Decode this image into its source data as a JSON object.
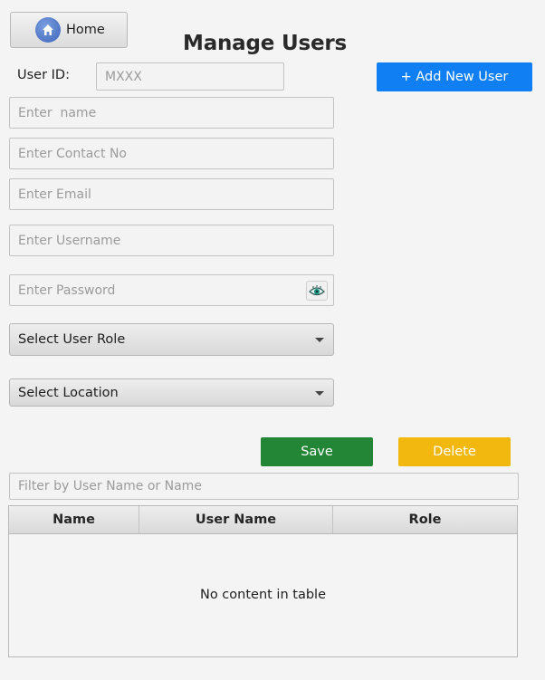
{
  "header": {
    "home_label": "Home",
    "title": "Manage Users"
  },
  "form": {
    "user_id_label": "User ID:",
    "user_id_placeholder": "MXXX",
    "add_new_user_label": "+ Add New User",
    "name_placeholder": "Enter  name",
    "contact_placeholder": "Enter Contact No",
    "email_placeholder": "Enter Email",
    "username_placeholder": "Enter Username",
    "password_placeholder": "Enter Password",
    "role_select_label": "Select User Role",
    "location_select_label": "Select Location"
  },
  "actions": {
    "save_label": "Save",
    "delete_label": "Delete"
  },
  "filter": {
    "placeholder": "Filter by User Name or Name"
  },
  "table": {
    "columns": [
      "Name",
      "User Name",
      "Role"
    ],
    "empty_message": "No content in table"
  },
  "colors": {
    "add_button": "#0f7ff3",
    "save_button": "#238636",
    "delete_button": "#f2b80f",
    "home_icon": "#3d64b8"
  },
  "icons": {
    "home": "home-icon",
    "password_toggle": "eye-icon",
    "dropdown": "chevron-down-icon"
  }
}
